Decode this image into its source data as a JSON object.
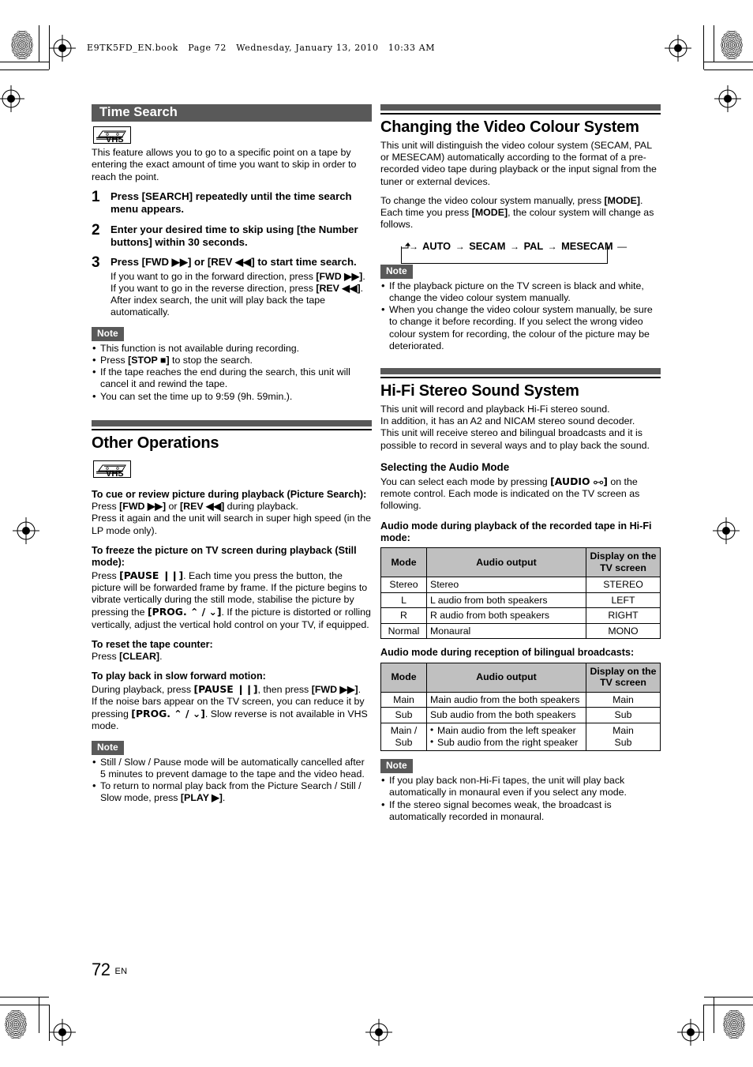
{
  "header_line": "E9TK5FD_EN.book   Page 72   Wednesday, January 13, 2010   10:33 AM",
  "page": {
    "number": "72",
    "lang": "EN"
  },
  "icons": {
    "vhs_label": "VHS"
  },
  "left_column": {
    "time_search": {
      "title": "Time Search",
      "intro": "This feature allows you to go to a specific point on a tape by entering the exact amount of time you want to skip in order to reach the point.",
      "steps": [
        {
          "num": "1",
          "title": "Press [SEARCH] repeatedly until the time search menu appears.",
          "body": ""
        },
        {
          "num": "2",
          "title": "Enter your desired time to skip using [the Number buttons] within 30 seconds.",
          "body": ""
        },
        {
          "num": "3",
          "title": "Press [FWD ▶▶] or [REV ◀◀] to start time search.",
          "body_1": "If you want to go in the forward direction, press ",
          "body_1_b": "[FWD ▶▶]",
          "body_1_end": ".",
          "body_2": "If you want to go in the reverse direction, press ",
          "body_2_b": "[REV ◀◀]",
          "body_2_end": ".",
          "body_3": "After index search, the unit will play back the tape automatically."
        }
      ],
      "note_label": "Note",
      "notes": [
        "This function is not available during recording.",
        "Press [STOP ■] to stop the search.",
        "If the tape reaches the end during the search, this unit will cancel it and rewind the tape.",
        "You can set the time up to 9:59 (9h. 59min.)."
      ],
      "note_2_pre": "Press ",
      "note_2_b": "[STOP ■]",
      "note_2_post": " to stop the search."
    },
    "other_operations": {
      "title": "Other Operations",
      "sub1_title": "To cue or review picture during playback (Picture Search):",
      "sub1_l1_pre": "Press ",
      "sub1_l1_b1": "[FWD ▶▶]",
      "sub1_l1_mid": " or ",
      "sub1_l1_b2": "[REV ◀◀]",
      "sub1_l1_post": " during playback.",
      "sub1_l2": "Press it again and the unit will search in super high speed (in the LP mode only).",
      "sub2_title": "To freeze the picture on TV screen during playback (Still mode):",
      "sub2_l1_pre": "Press ",
      "sub2_l1_b": "[PAUSE ❙❙]",
      "sub2_l1_post": ". Each time you press the button, the picture will be forwarded frame by frame.",
      "sub2_l2_pre": "If the picture begins to vibrate vertically during the still mode, stabilise the picture by pressing the ",
      "sub2_l2_b": "[PROG. ⌃ / ⌄]",
      "sub2_l2_post": ". If the picture is distorted or rolling vertically, adjust the vertical hold control on your TV, if equipped.",
      "sub3_title": "To reset the tape counter:",
      "sub3_pre": "Press ",
      "sub3_b": "[CLEAR]",
      "sub3_post": ".",
      "sub4_title": "To play back in slow forward motion:",
      "sub4_l1_pre": "During playback, press ",
      "sub4_l1_b1": "[PAUSE ❙❙]",
      "sub4_l1_mid": ", then press ",
      "sub4_l1_b2": "[FWD ▶▶]",
      "sub4_l1_post": ".",
      "sub4_l2_pre": "If the noise bars appear on the TV screen, you can reduce it by pressing ",
      "sub4_l2_b": "[PROG. ⌃ / ⌄]",
      "sub4_l2_post": ". Slow reverse is not available in VHS mode.",
      "note_label": "Note",
      "note1": "Still / Slow / Pause mode will be automatically cancelled after 5 minutes to prevent damage to the tape and the video head.",
      "note2_pre": "To return to normal play back from the Picture Search / Still / Slow mode, press ",
      "note2_b": "[PLAY ▶]",
      "note2_post": "."
    }
  },
  "right_column": {
    "video_colour": {
      "title": "Changing the Video Colour System",
      "p1": "This unit will distinguish the video colour system (SECAM, PAL or MESECAM) automatically according to the format of a pre-recorded video tape during playback or the input signal from the tuner or external devices.",
      "p2_pre": "To change the video colour system manually, press ",
      "p2_b1": "[MODE]",
      "p2_mid": ". Each time you press ",
      "p2_b2": "[MODE]",
      "p2_post": ", the colour system will change as follows.",
      "cycle": [
        "AUTO",
        "SECAM",
        "PAL",
        "MESECAM"
      ],
      "cycle_arrow": "→",
      "note_label": "Note",
      "notes": [
        "If the playback picture on the TV screen is black and white, change the video colour system manually.",
        "When you change the video colour system manually, be sure to change it before recording. If you select the wrong video colour system for recording, the colour of the picture may be deteriorated."
      ]
    },
    "hifi": {
      "title": "Hi-Fi Stereo Sound System",
      "p1": "This unit will record and playback Hi-Fi stereo sound.",
      "p2": "In addition, it has an A2 and NICAM stereo sound decoder.",
      "p3": "This unit will receive stereo and bilingual broadcasts and it is possible to record in several ways and to play back the sound.",
      "sub_title": "Selecting the Audio Mode",
      "sub_p_pre": "You can select each mode by pressing ",
      "sub_p_b": "[AUDIO ⧟]",
      "sub_p_post": " on the remote control. Each mode is indicated on the TV screen as following.",
      "table1_caption": "Audio mode during playback of the recorded tape in Hi-Fi mode:",
      "table1": {
        "headers": [
          "Mode",
          "Audio output",
          "Display on the TV screen"
        ],
        "rows": [
          [
            "Stereo",
            "Stereo",
            "STEREO"
          ],
          [
            "L",
            "L audio from both speakers",
            "LEFT"
          ],
          [
            "R",
            "R audio from both speakers",
            "RIGHT"
          ],
          [
            "Normal",
            "Monaural",
            "MONO"
          ]
        ]
      },
      "table2_caption": "Audio mode during reception of bilingual broadcasts:",
      "table2": {
        "headers": [
          "Mode",
          "Audio output",
          "Display on the TV screen"
        ],
        "rows": [
          [
            "Main",
            "Main audio from the both speakers",
            "Main"
          ],
          [
            "Sub",
            "Sub audio from the both speakers",
            "Sub"
          ]
        ],
        "row3_mode": "Main / Sub",
        "row3_out": [
          "Main audio from the left speaker",
          "Sub audio from the right speaker"
        ],
        "row3_disp": "Main\nSub"
      },
      "note_label": "Note",
      "notes": [
        "If you play back non-Hi-Fi tapes, the unit will play back automatically in monaural even if you select any mode.",
        "If the stereo signal becomes weak, the broadcast is automatically recorded in monaural."
      ]
    }
  },
  "colors": {
    "bar_gray": "#595959",
    "table_header_gray": "#c0c0c0",
    "text": "#000000"
  }
}
